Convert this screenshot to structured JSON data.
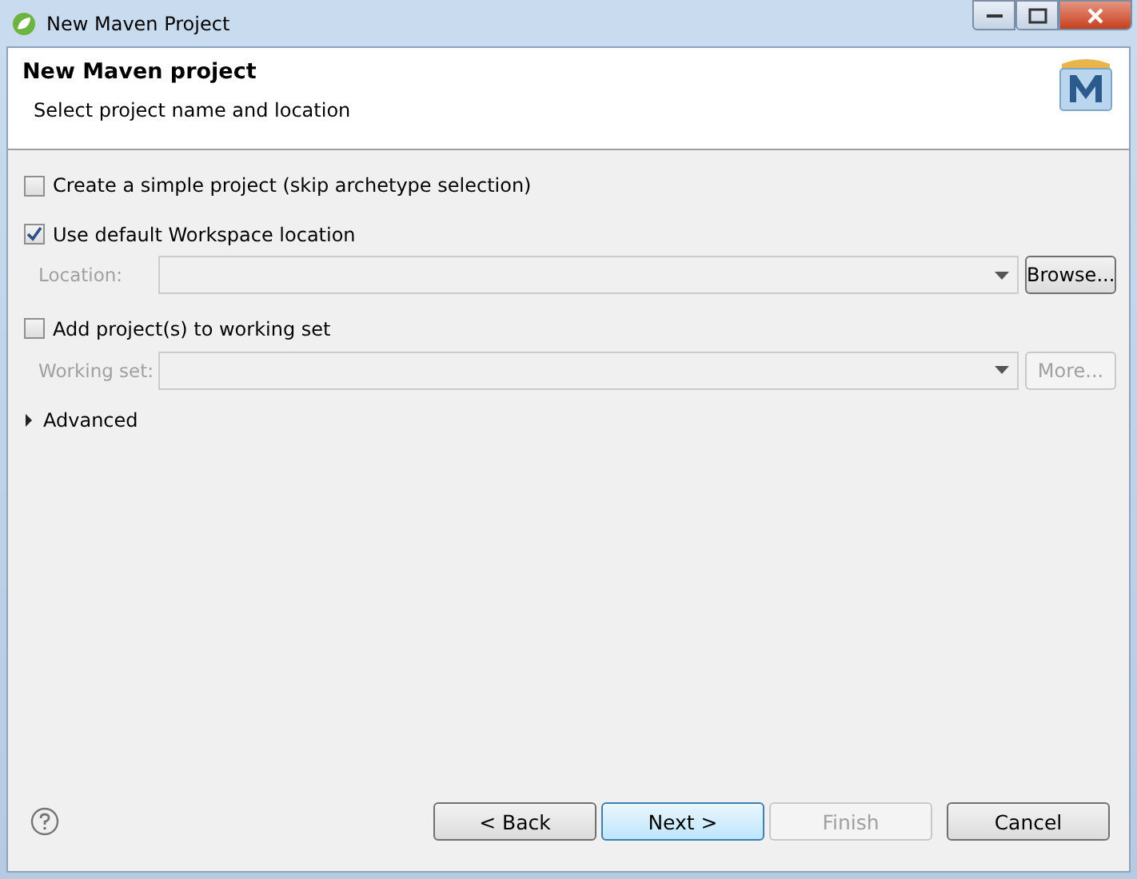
{
  "window": {
    "title": "New Maven Project"
  },
  "header": {
    "title": "New Maven project",
    "subtitle": "Select project name and location"
  },
  "simple_project": {
    "label": "Create a simple project (skip archetype selection)",
    "checked": false
  },
  "workspace": {
    "label": "Use default Workspace location",
    "checked": true
  },
  "location": {
    "label": "Location:",
    "disabled": true,
    "button": "Browse...",
    "button_disabled": false
  },
  "working_set_option": {
    "label": "Add project(s) to working set",
    "checked": false
  },
  "working_set": {
    "label": "Working set:",
    "disabled": true,
    "button": "More...",
    "button_disabled": true
  },
  "advanced": {
    "label": "Advanced",
    "expanded": false
  },
  "buttons": [
    {
      "label": "< Back",
      "disabled": false,
      "default": false
    },
    {
      "label": "Next >",
      "disabled": false,
      "default": true
    },
    {
      "label": "Finish",
      "disabled": true,
      "default": false
    },
    {
      "label": "Cancel",
      "disabled": false,
      "default": false
    }
  ]
}
